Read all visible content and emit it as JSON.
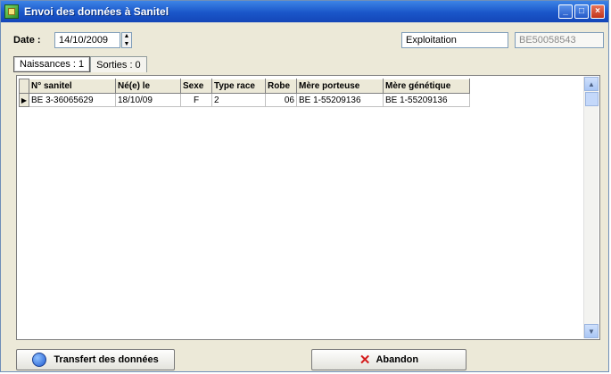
{
  "window": {
    "title": "Envoi des données à Sanitel",
    "icon": "app-icon"
  },
  "header": {
    "date_label": "Date :",
    "date_value": "14/10/2009",
    "exploitation_label": "Exploitation",
    "exploitation_value": "BE50058543"
  },
  "tabs": [
    {
      "label": "Naissances : 1",
      "active": true
    },
    {
      "label": "Sorties : 0",
      "active": false
    }
  ],
  "table": {
    "columns": [
      "N° sanitel",
      "Né(e) le",
      "Sexe",
      "Type race",
      "Robe",
      "Mère porteuse",
      "Mère génétique"
    ],
    "rows": [
      [
        "BE 3-36065629",
        "18/10/09",
        "F",
        "2",
        "06",
        "BE 1-55209136",
        "BE 1-55209136"
      ]
    ]
  },
  "buttons": {
    "transfer": "Transfert des données",
    "cancel": "Abandon"
  }
}
